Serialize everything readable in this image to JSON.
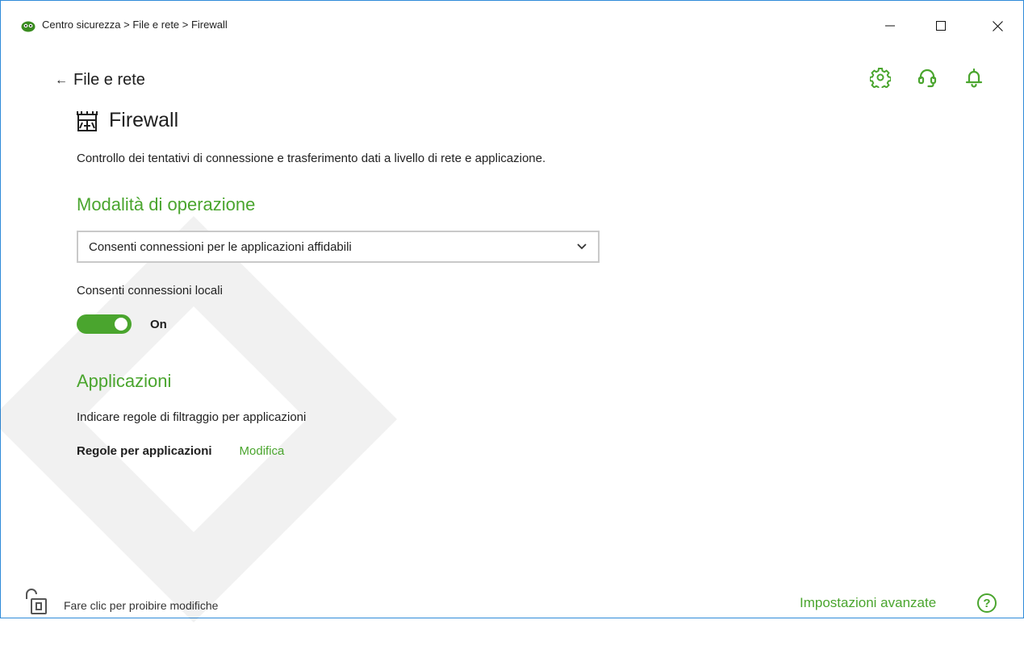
{
  "window": {
    "title": "Centro sicurezza > File e rete > Firewall",
    "controls": {
      "minimize": "—",
      "maximize": "☐",
      "close": "✕"
    }
  },
  "nav": {
    "back_label": "File e rete"
  },
  "header_icons": [
    "gear-icon",
    "support-headset-icon",
    "bell-icon"
  ],
  "page": {
    "title": "Firewall",
    "icon": "castle-icon",
    "description": "Controllo dei tentativi di connessione e trasferimento dati a livello di rete e applicazione."
  },
  "mode_section": {
    "title": "Modalità di operazione",
    "selected_option": "Consenti connessioni per le applicazioni affidabili",
    "local_label": "Consenti connessioni locali",
    "toggle_state": "On",
    "toggle_on": true
  },
  "apps_section": {
    "title": "Applicazioni",
    "description": "Indicare regole di filtraggio per applicazioni",
    "rules_label": "Regole per applicazioni",
    "rules_link": "Modifica"
  },
  "footer": {
    "lock_text": "Fare clic per proibire modifiche",
    "advanced_link": "Impostazioni avanzate",
    "help_label": "?"
  },
  "colors": {
    "accent": "#4aa52e",
    "border": "#2f8bd9",
    "text": "#1e1e1e"
  }
}
